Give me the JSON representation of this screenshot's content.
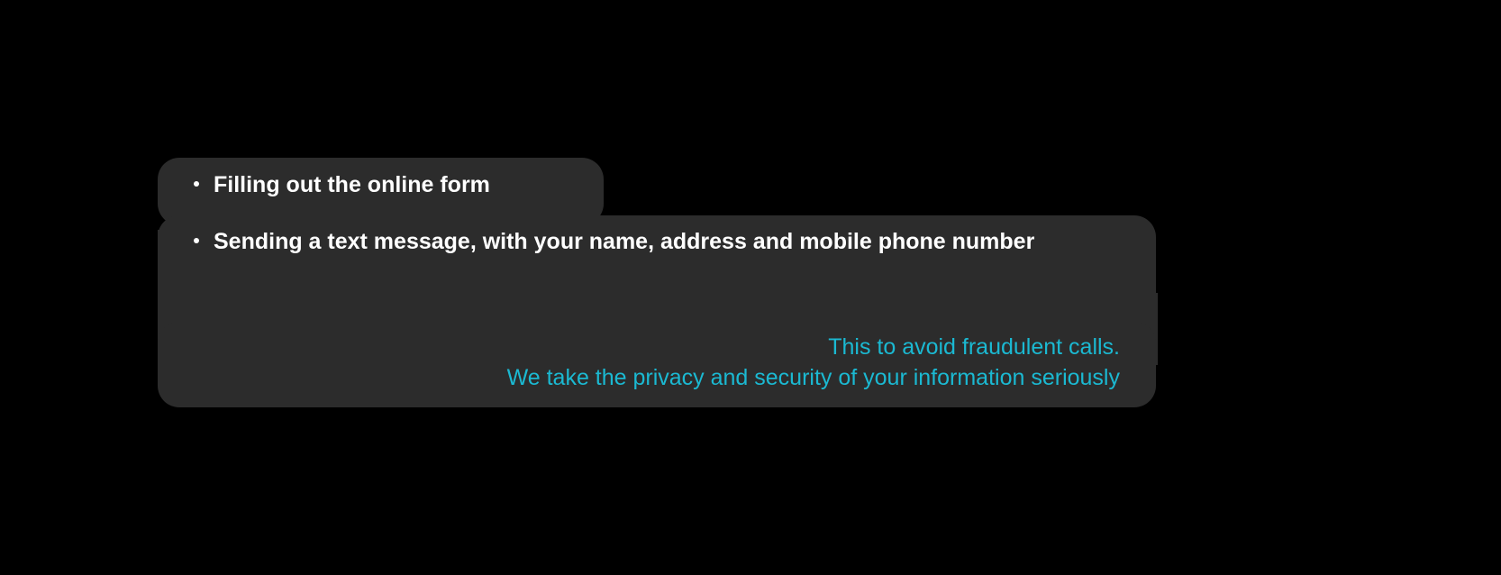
{
  "bullets": {
    "item1": "Filling out the online form",
    "item2": "Sending a text message, with your name, address and mobile phone number"
  },
  "notice": {
    "line1": "This to avoid fraudulent calls.",
    "line2": "We take the privacy and security of your information seriously"
  },
  "colors": {
    "background": "#000000",
    "panel": "#2c2c2c",
    "text_primary": "#ffffff",
    "text_accent": "#1bb9d2"
  }
}
